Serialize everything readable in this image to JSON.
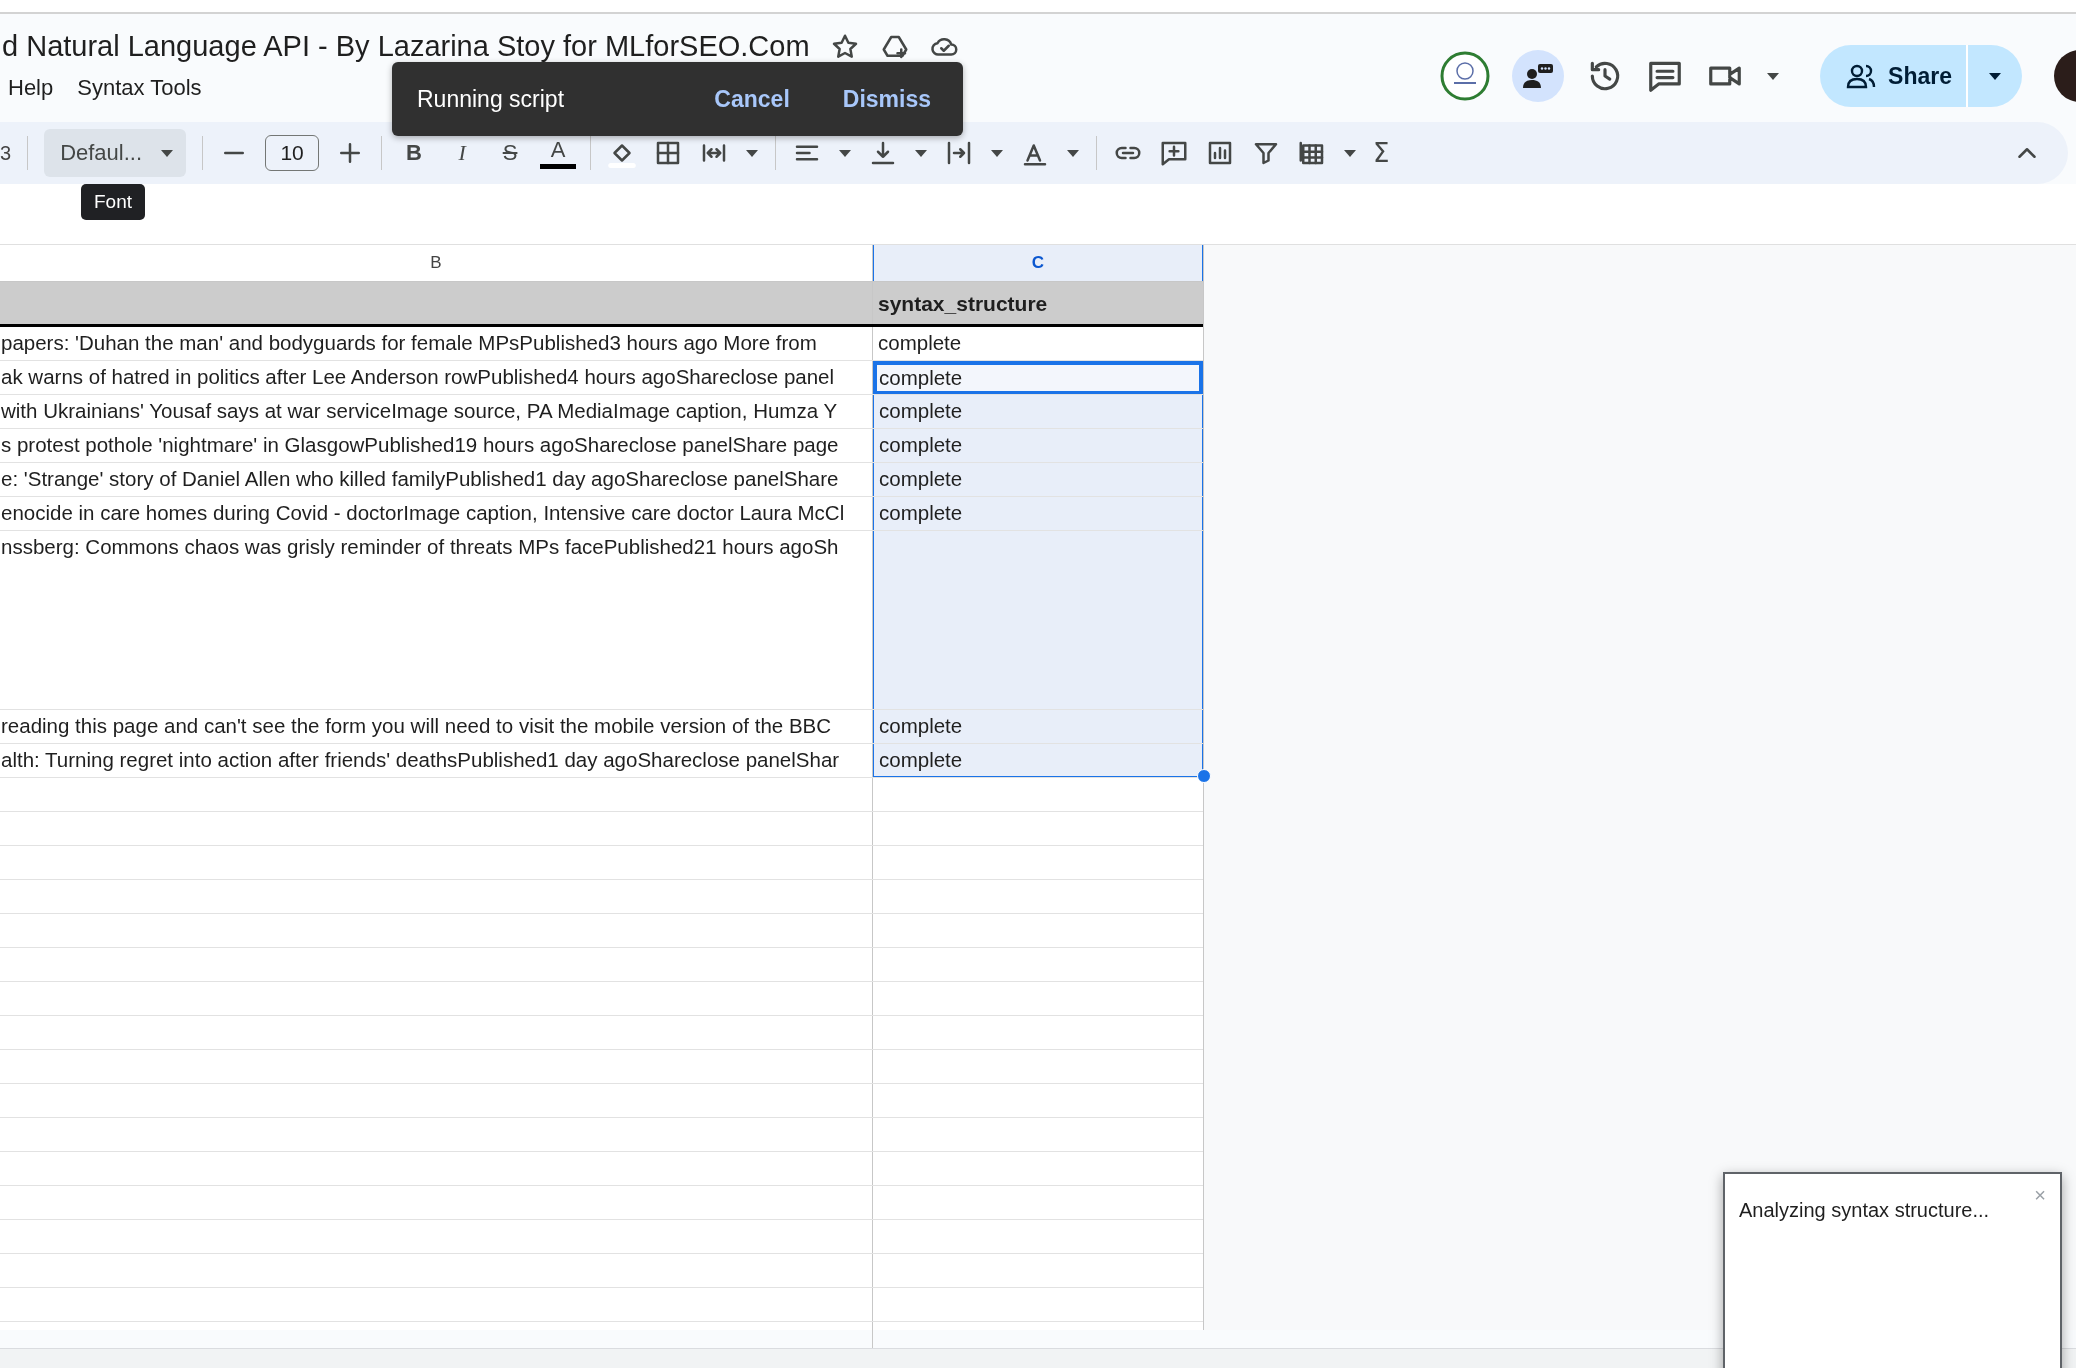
{
  "document_title": "d Natural Language API - By Lazarina Stoy for MLforSEO.Com",
  "menu": [
    "Help",
    "Syntax Tools"
  ],
  "share_button": "Share",
  "snackbar": {
    "message": "Running script",
    "actions": [
      "Cancel",
      "Dismiss"
    ]
  },
  "toolbar": {
    "zoom_fragment": "3",
    "font": "Defaul...",
    "font_size": "10",
    "functions_label": "Σ",
    "tooltip": "Font",
    "format_buttons": [
      {
        "label": "B",
        "kind": "bold"
      },
      {
        "label": "I",
        "kind": "italic"
      },
      {
        "label": "S",
        "kind": "strike"
      },
      {
        "label": "A",
        "kind": "color"
      }
    ]
  },
  "sheet": {
    "columns": [
      {
        "label": "B",
        "selected": false
      },
      {
        "label": "C",
        "selected": true
      }
    ],
    "rows": [
      {
        "kind": "header",
        "label": "syntax_structure"
      },
      {
        "kind": "normal",
        "text": " papers: 'Duhan the man' and bodyguards for female MPsPublished3 hours ago More from",
        "status": "complete",
        "selected": false,
        "active": false
      },
      {
        "kind": "normal",
        "text": "ak warns of hatred in politics after Lee Anderson rowPublished4 hours agoShareclose panel",
        "status": "complete",
        "selected": true,
        "active": true
      },
      {
        "kind": "normal",
        "text": "with Ukrainians' Yousaf says at war serviceImage source, PA MediaImage caption, Humza Y",
        "status": "complete",
        "selected": true,
        "active": false
      },
      {
        "kind": "normal",
        "text": "s protest pothole 'nightmare' in GlasgowPublished19 hours agoShareclose panelShare page",
        "status": "complete",
        "selected": true,
        "active": false
      },
      {
        "kind": "normal",
        "text": "e: 'Strange' story of Daniel Allen who killed familyPublished1 day agoShareclose panelShare",
        "status": "complete",
        "selected": true,
        "active": false
      },
      {
        "kind": "normal",
        "text": "enocide in care homes during Covid - doctorImage caption, Intensive care doctor Laura McCl",
        "status": "complete",
        "selected": true,
        "active": false
      },
      {
        "kind": "tall",
        "text": "nssberg: Commons chaos was grisly reminder of threats MPs facePublished21 hours agoSh",
        "selected": true,
        "active": false
      },
      {
        "kind": "normal",
        "text": "reading this page and can't see the form you will need to visit the mobile version of the BBC",
        "status": "complete",
        "selected": true,
        "active": false
      },
      {
        "kind": "normal",
        "text": "alth: Turning regret into action after friends' deathsPublished1 day agoShareclose panelShar",
        "status": "complete",
        "selected": true,
        "active": false
      }
    ]
  },
  "dialog": {
    "message": "Analyzing syntax structure...",
    "close": "×"
  }
}
